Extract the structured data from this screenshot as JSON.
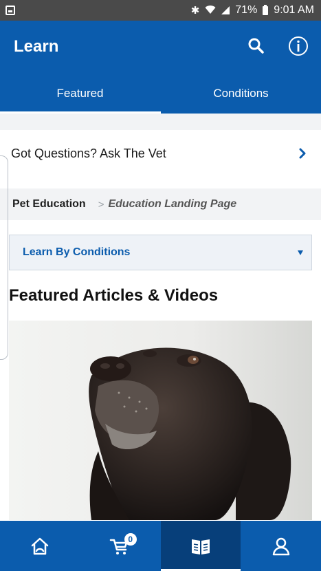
{
  "status_bar": {
    "battery_percent": "71%",
    "time": "9:01 AM",
    "icons": [
      "notification-icon",
      "bluetooth-icon",
      "wifi-icon",
      "signal-icon",
      "battery-icon"
    ]
  },
  "header": {
    "title": "Learn",
    "icons": [
      "search-icon",
      "info-icon"
    ],
    "tabs": [
      {
        "label": "Featured",
        "selected": true
      },
      {
        "label": "Conditions",
        "selected": false
      }
    ]
  },
  "ask_vet": {
    "label": "Got Questions? Ask The Vet",
    "icon": "chevron-right-icon"
  },
  "breadcrumb": {
    "items": [
      "Pet Education",
      "Education Landing Page"
    ],
    "separator": ">"
  },
  "conditions_select": {
    "selected": "Learn By Conditions"
  },
  "featured": {
    "title": "Featured Articles & Videos"
  },
  "bottom_nav": {
    "items": [
      {
        "icon": "home-icon"
      },
      {
        "icon": "cart-icon",
        "badge": "0"
      },
      {
        "icon": "book-icon",
        "active": true
      },
      {
        "icon": "profile-icon"
      }
    ]
  },
  "colors": {
    "brand_blue": "#0b5cad",
    "active_nav": "#073f7a",
    "light_gray": "#f2f3f5"
  }
}
